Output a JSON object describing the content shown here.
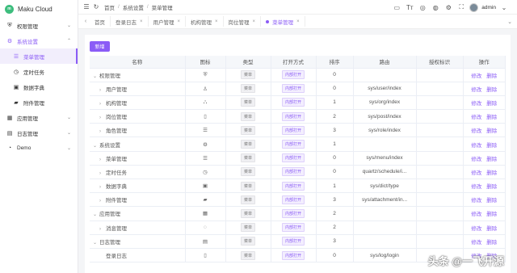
{
  "app": {
    "title": "Maku Cloud",
    "logo_text": "m"
  },
  "sidebar": {
    "items": [
      {
        "label": "权限管理",
        "icon": "shield-icon",
        "glyph": "⛨",
        "chev": "⌄"
      },
      {
        "label": "系统设置",
        "icon": "gear-icon",
        "glyph": "⚙",
        "chev": "⌃"
      },
      {
        "label": "应用管理",
        "icon": "appstore-icon",
        "glyph": "▦",
        "chev": "⌄"
      },
      {
        "label": "日志管理",
        "icon": "log-icon",
        "glyph": "▤",
        "chev": "⌄"
      },
      {
        "label": "Demo",
        "icon": "demo-icon",
        "glyph": "◔",
        "chev": "⌄"
      }
    ],
    "sub_items": [
      {
        "label": "菜单管理",
        "glyph": "☰"
      },
      {
        "label": "定时任务",
        "glyph": "◷"
      },
      {
        "label": "数据字典",
        "glyph": "▣"
      },
      {
        "label": "附件管理",
        "glyph": "▰"
      }
    ]
  },
  "topbar": {
    "breadcrumb": [
      "首页",
      "系统设置",
      "菜单管理"
    ],
    "user": "admin",
    "icons": {
      "menu": "☰",
      "refresh": "↻",
      "bookmark": "▭",
      "font": "Tт",
      "globe": "◎",
      "github": "◍",
      "settings": "⚙",
      "fullscreen": "⛶",
      "caret": "⌄"
    }
  },
  "tabs": [
    {
      "label": "首页",
      "closable": false
    },
    {
      "label": "登录日志",
      "closable": true
    },
    {
      "label": "用户管理",
      "closable": true
    },
    {
      "label": "机构管理",
      "closable": true
    },
    {
      "label": "岗位管理",
      "closable": true
    },
    {
      "label": "菜单管理",
      "closable": true,
      "active": true
    }
  ],
  "tab_nav": {
    "left": "‹",
    "right": "⌄",
    "close": "×"
  },
  "toolbar": {
    "add_label": "新增"
  },
  "table": {
    "headers": [
      "名称",
      "图标",
      "类型",
      "打开方式",
      "排序",
      "路由",
      "授权标识",
      "操作"
    ],
    "rows": [
      {
        "level": 0,
        "caret": "⌄",
        "name": "权限管理",
        "icon": "⛨",
        "type": "菜单",
        "open": "内部打开",
        "sort": "0",
        "route": "",
        "perm": ""
      },
      {
        "level": 1,
        "caret": "›",
        "name": "用户管理",
        "icon": "♙",
        "type": "菜单",
        "open": "内部打开",
        "sort": "0",
        "route": "sys/user/index",
        "perm": ""
      },
      {
        "level": 1,
        "caret": "›",
        "name": "机构管理",
        "icon": "⛬",
        "type": "菜单",
        "open": "内部打开",
        "sort": "1",
        "route": "sys/org/index",
        "perm": ""
      },
      {
        "level": 1,
        "caret": "›",
        "name": "岗位管理",
        "icon": "▯",
        "type": "菜单",
        "open": "内部打开",
        "sort": "2",
        "route": "sys/post/index",
        "perm": ""
      },
      {
        "level": 1,
        "caret": "›",
        "name": "角色管理",
        "icon": "☰",
        "type": "菜单",
        "open": "内部打开",
        "sort": "3",
        "route": "sys/role/index",
        "perm": ""
      },
      {
        "level": 0,
        "caret": "⌄",
        "name": "系统设置",
        "icon": "⚙",
        "type": "菜单",
        "open": "内部打开",
        "sort": "1",
        "route": "",
        "perm": ""
      },
      {
        "level": 1,
        "caret": "›",
        "name": "菜单管理",
        "icon": "☰",
        "type": "菜单",
        "open": "内部打开",
        "sort": "0",
        "route": "sys/menu/index",
        "perm": ""
      },
      {
        "level": 1,
        "caret": "›",
        "name": "定时任务",
        "icon": "◷",
        "type": "菜单",
        "open": "内部打开",
        "sort": "0",
        "route": "quartz/schedule/i...",
        "perm": ""
      },
      {
        "level": 1,
        "caret": "›",
        "name": "数据字典",
        "icon": "▣",
        "type": "菜单",
        "open": "内部打开",
        "sort": "1",
        "route": "sys/dict/type",
        "perm": ""
      },
      {
        "level": 1,
        "caret": "›",
        "name": "附件管理",
        "icon": "▰",
        "type": "菜单",
        "open": "内部打开",
        "sort": "3",
        "route": "sys/attachment/in...",
        "perm": ""
      },
      {
        "level": 0,
        "caret": "⌄",
        "name": "应用管理",
        "icon": "▦",
        "type": "菜单",
        "open": "内部打开",
        "sort": "2",
        "route": "",
        "perm": ""
      },
      {
        "level": 1,
        "caret": "›",
        "name": "消息管理",
        "icon": "◌",
        "type": "菜单",
        "open": "内部打开",
        "sort": "2",
        "route": "",
        "perm": ""
      },
      {
        "level": 0,
        "caret": "⌄",
        "name": "日志管理",
        "icon": "▤",
        "type": "菜单",
        "open": "内部打开",
        "sort": "3",
        "route": "",
        "perm": ""
      },
      {
        "level": 1,
        "caret": "",
        "name": "登录日志",
        "icon": "▯",
        "type": "菜单",
        "open": "内部打开",
        "sort": "0",
        "route": "sys/log/login",
        "perm": ""
      }
    ],
    "edit_label": "修改",
    "delete_label": "删除"
  },
  "watermark": "头条 @一飞开源",
  "colors": {
    "accent": "#8b5cf6",
    "logo": "#3dbd7d"
  }
}
